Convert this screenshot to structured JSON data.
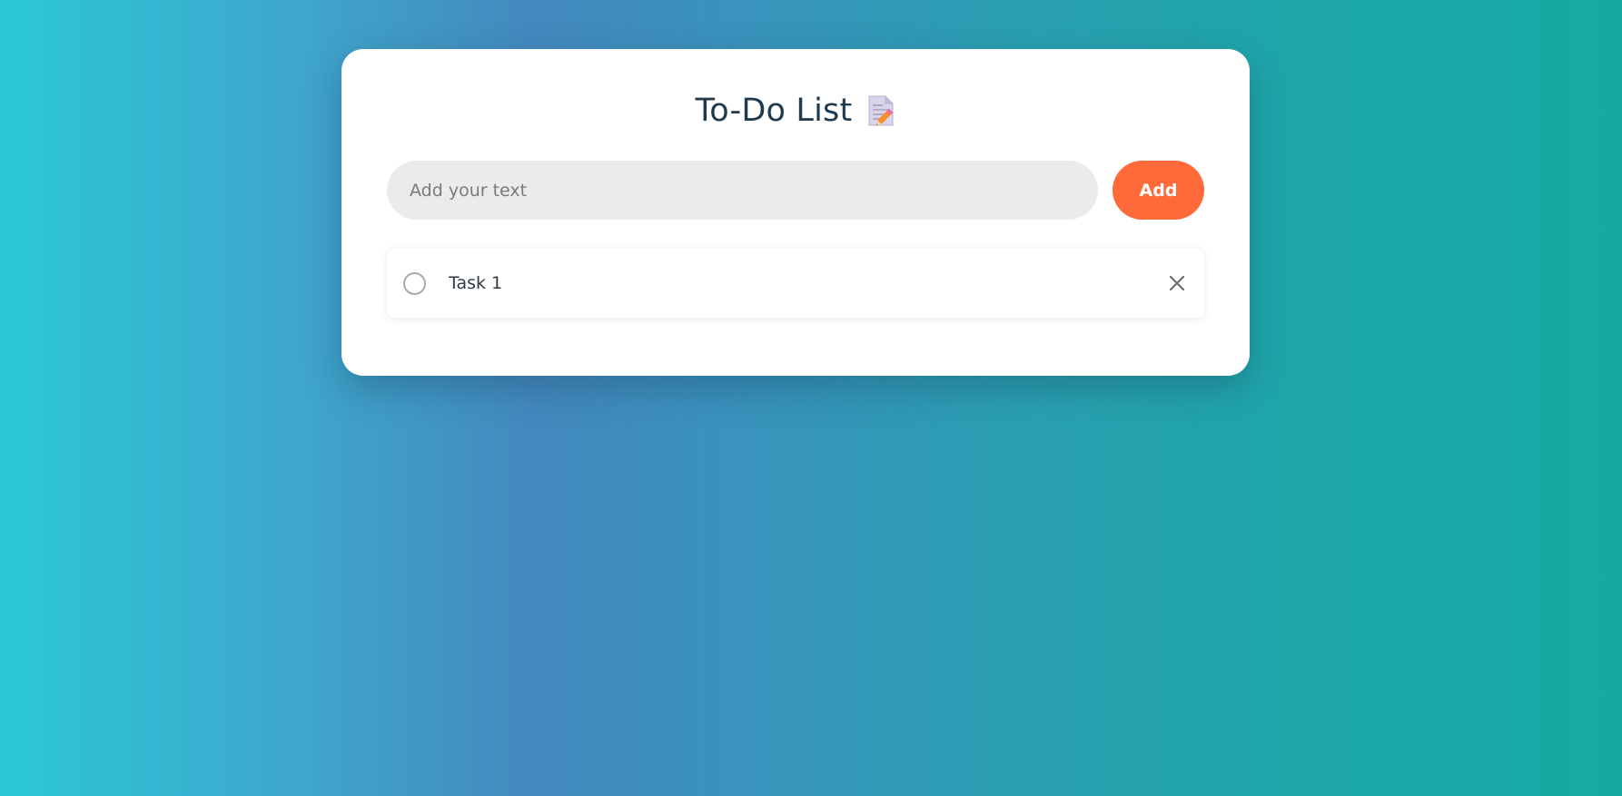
{
  "header": {
    "title": "To-Do List",
    "icon": "memo-icon"
  },
  "input": {
    "placeholder": "Add your text",
    "value": ""
  },
  "add_button": {
    "label": "Add"
  },
  "tasks": [
    {
      "text": "Task 1",
      "completed": false
    }
  ],
  "colors": {
    "accent": "#ff6a3b",
    "title_text": "#1f3a4d",
    "input_background": "#edebea",
    "card_background": "#ffffff",
    "background_gradient": [
      "#2bc8d8",
      "#4489bf",
      "#14aaa3"
    ]
  }
}
